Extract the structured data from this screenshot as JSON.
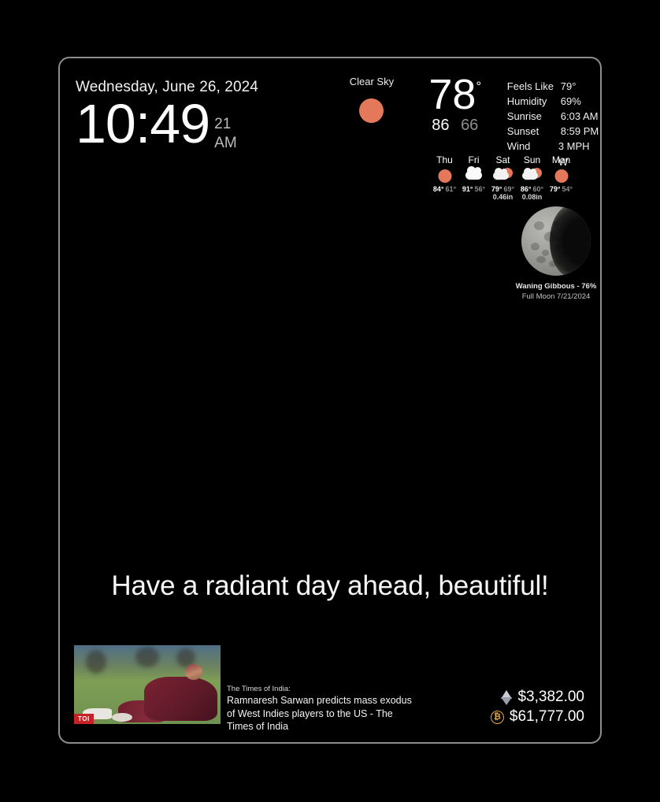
{
  "clock": {
    "date": "Wednesday, June 26, 2024",
    "time": "10:49",
    "seconds": "21",
    "ampm": "AM"
  },
  "weather": {
    "condition": "Clear Sky",
    "condition_icon": "sun-icon",
    "temperature": "78",
    "degree_symbol": "°",
    "high": "86",
    "low": "66",
    "details": [
      {
        "key": "Feels Like",
        "value": "79°"
      },
      {
        "key": "Humidity",
        "value": "69%"
      },
      {
        "key": "Sunrise",
        "value": "6:03 AM"
      },
      {
        "key": "Sunset",
        "value": "8:59 PM"
      },
      {
        "key": "Wind",
        "value": "3 MPH W"
      }
    ],
    "accent_color": "#e3795a"
  },
  "forecast": [
    {
      "day": "Thu",
      "icon": "sun-icon",
      "high": "84°",
      "low": "61°",
      "precip": ""
    },
    {
      "day": "Fri",
      "icon": "cloud-icon",
      "high": "91°",
      "low": "56°",
      "precip": ""
    },
    {
      "day": "Sat",
      "icon": "sun-behind-rain-cloud-icon",
      "high": "79°",
      "low": "69°",
      "precip": "0.46in"
    },
    {
      "day": "Sun",
      "icon": "sun-behind-rain-cloud-icon",
      "high": "86°",
      "low": "60°",
      "precip": "0.08in"
    },
    {
      "day": "Mon",
      "icon": "sun-icon",
      "high": "79°",
      "low": "54°",
      "precip": ""
    }
  ],
  "moon": {
    "phase": "Waning Gibbous - 76%",
    "full_moon": "Full Moon 7/21/2024"
  },
  "greeting": "Have a radiant day ahead, beautiful!",
  "news": {
    "source": "The Times of India:",
    "headline": "Ramnaresh Sarwan predicts mass exodus of West Indies players to the US - The Times of India",
    "thumbnail_badge": "TOI"
  },
  "crypto": [
    {
      "name": "ethereum",
      "icon": "ethereum-icon",
      "price": "$3,382.00"
    },
    {
      "name": "bitcoin",
      "icon": "bitcoin-icon",
      "symbol": "₿",
      "price": "$61,777.00"
    }
  ]
}
